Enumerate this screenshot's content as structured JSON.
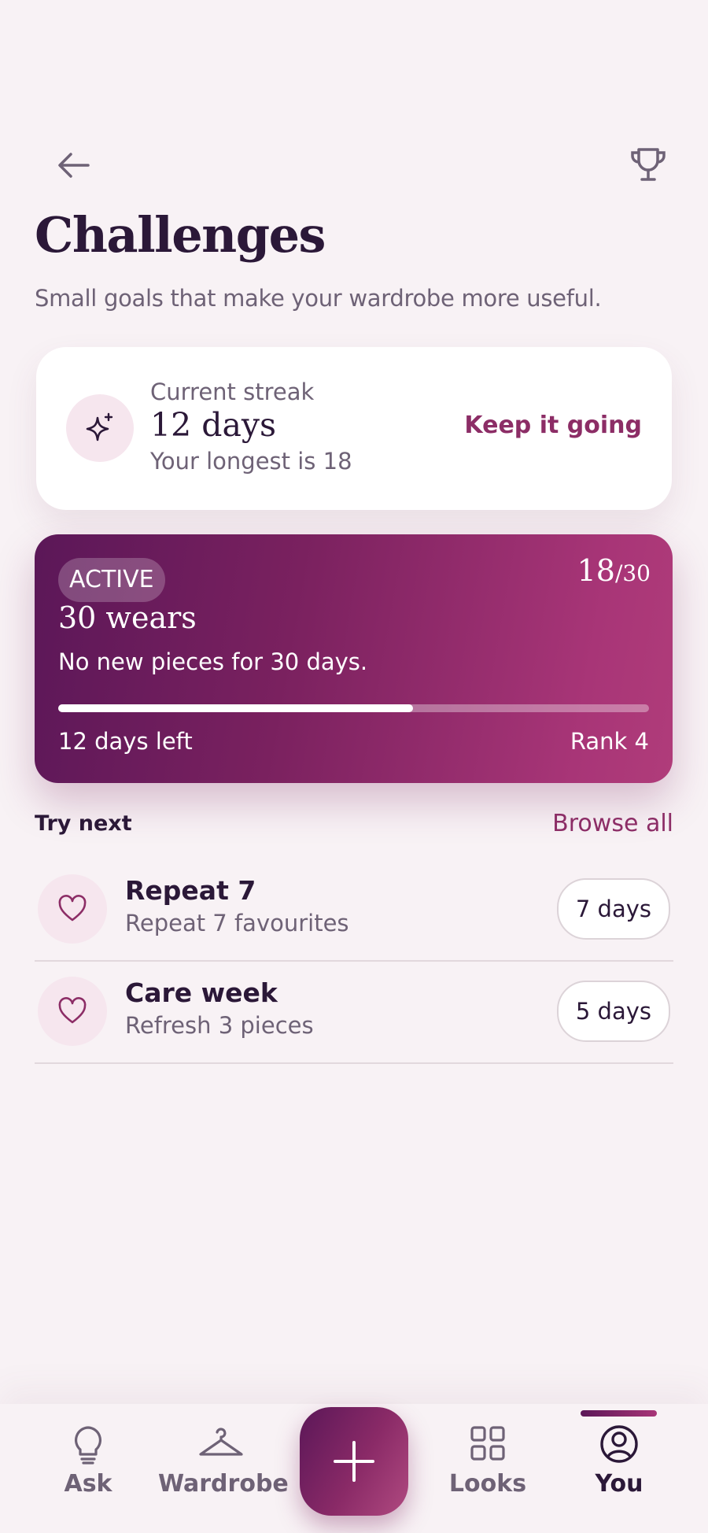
{
  "header": {
    "title": "Challenges",
    "subtitle": "Small goals that make your wardrobe more useful.",
    "back_icon": "arrow-left-icon",
    "trophy_icon": "trophy-icon"
  },
  "streak": {
    "label": "Current streak",
    "value": "12 days",
    "longest": "Your longest is 18",
    "action": "Keep it going",
    "icon": "sparkle-icon"
  },
  "active_challenge": {
    "badge": "ACTIVE",
    "progress_current": "18",
    "progress_total": "/30",
    "progress_fraction": 0.6,
    "title": "30 wears",
    "description": "No new pieces for 30 days.",
    "days_left": "12 days left",
    "rank": "Rank 4"
  },
  "try_next": {
    "heading": "Try next",
    "browse_label": "Browse all",
    "items": [
      {
        "title": "Repeat 7",
        "subtitle": "Repeat 7 favourites",
        "duration": "7 days",
        "icon": "heart-icon"
      },
      {
        "title": "Care week",
        "subtitle": "Refresh 3 pieces",
        "duration": "5 days",
        "icon": "heart-icon"
      }
    ]
  },
  "tabbar": {
    "tabs": [
      {
        "label": "Ask",
        "icon": "lightbulb-icon"
      },
      {
        "label": "Wardrobe",
        "icon": "hanger-icon"
      },
      {
        "label": "Looks",
        "icon": "grid-icon"
      },
      {
        "label": "You",
        "icon": "user-circle-icon",
        "active": true
      }
    ],
    "fab_icon": "plus-icon"
  },
  "colors": {
    "background": "#f8f2f5",
    "text": "#2b1838",
    "muted": "#6e6276",
    "accent": "#8c2d66",
    "gradient_start": "#5b1758",
    "gradient_end": "#b03c7a"
  }
}
